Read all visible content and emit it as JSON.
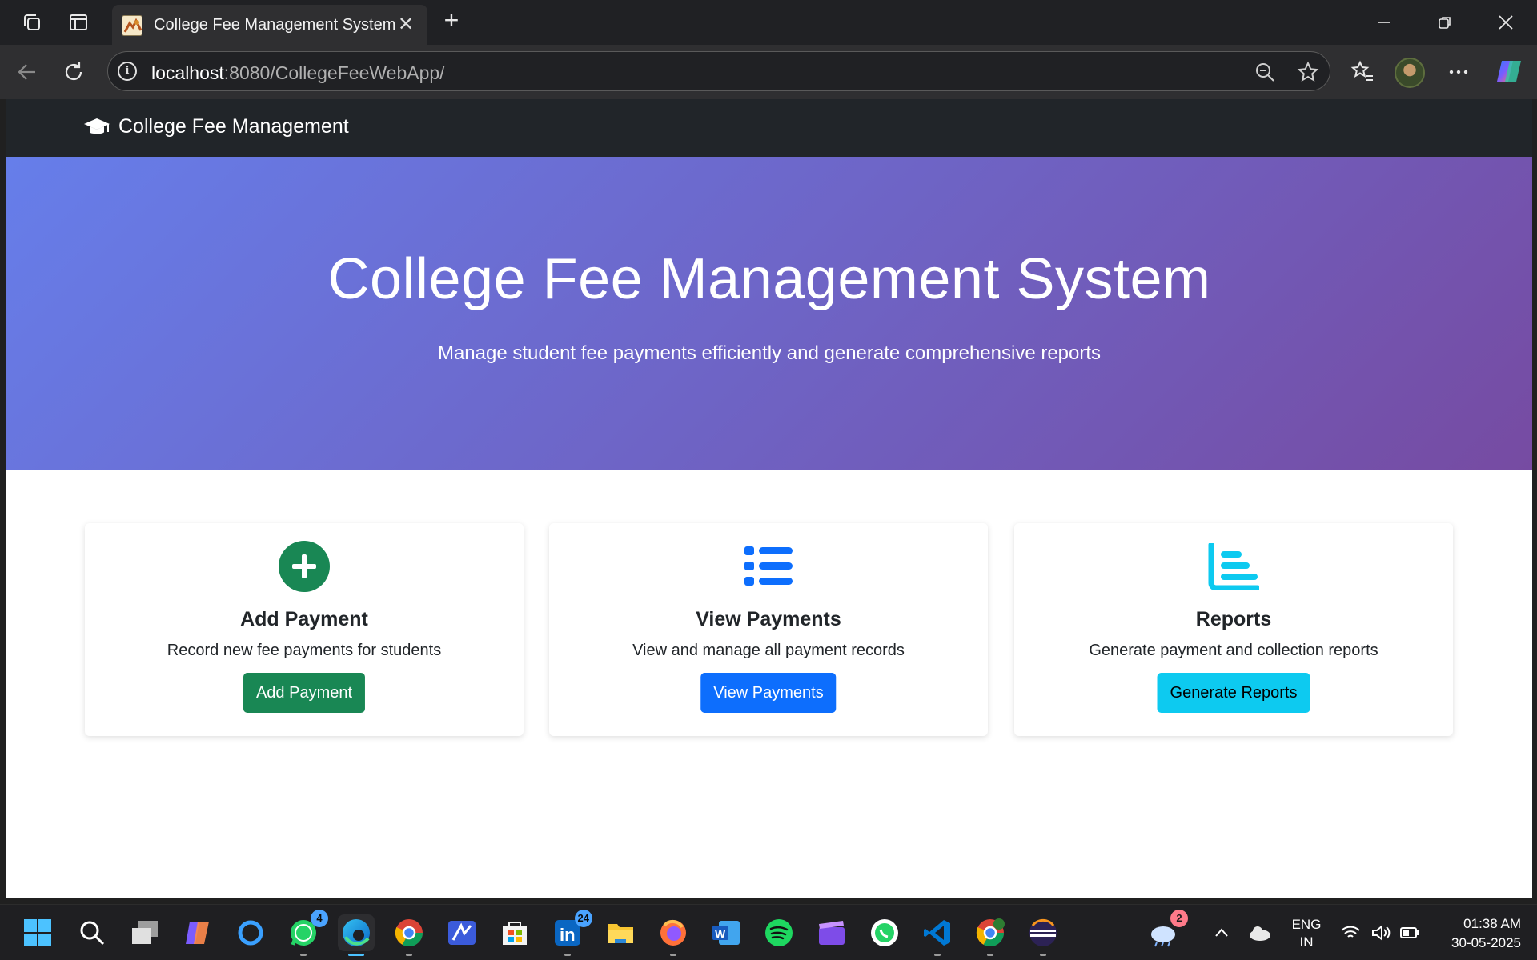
{
  "browser": {
    "tab_title": "College Fee Management System",
    "url_host": "localhost",
    "url_rest": ":8080/CollegeFeeWebApp/",
    "icons": [
      "workspaces-icon",
      "vertical-tabs-icon",
      "tab-favicon-icon",
      "close-icon",
      "new-tab-icon",
      "minimize-icon",
      "restore-icon",
      "window-close-icon",
      "back-icon",
      "refresh-icon",
      "site-info-icon",
      "zoom-out-icon",
      "favorite-star-icon",
      "favorites-icon",
      "profile-avatar",
      "more-icon",
      "copilot-icon"
    ]
  },
  "app": {
    "brand": "College Fee Management",
    "hero": {
      "title": "College Fee Management System",
      "subtitle": "Manage student fee payments efficiently and generate comprehensive reports"
    },
    "cards": [
      {
        "title": "Add Payment",
        "text": "Record new fee payments for students",
        "button": "Add Payment",
        "icon": "plus-circle-icon",
        "color": "#198754"
      },
      {
        "title": "View Payments",
        "text": "View and manage all payment records",
        "button": "View Payments",
        "icon": "list-icon",
        "color": "#0d6efd"
      },
      {
        "title": "Reports",
        "text": "Generate payment and collection reports",
        "button": "Generate Reports",
        "icon": "chart-bar-icon",
        "color": "#0dcaf0"
      }
    ],
    "colors": {
      "navbar": "#212529",
      "hero_start": "#667eea",
      "hero_end": "#764ba2"
    }
  },
  "taskbar": {
    "apps": [
      "start-icon",
      "search-icon",
      "task-view-icon",
      "copilot-app-icon",
      "cortana-icon",
      "whatsapp-icon",
      "edge-icon",
      "chrome-icon",
      "vs-studio-icon",
      "ms-store-icon",
      "linkedin-icon",
      "file-explorer-icon",
      "firefox-icon",
      "word-icon",
      "spotify-icon",
      "clipchamp-icon",
      "whatsapp-business-icon",
      "vscode-icon",
      "chrome-profile-icon",
      "eclipse-icon"
    ],
    "badges": {
      "whatsapp": "4",
      "linkedin": "24",
      "weather": "2"
    },
    "lang_top": "ENG",
    "lang_bottom": "IN",
    "time": "01:38 AM",
    "date": "30-05-2025"
  }
}
